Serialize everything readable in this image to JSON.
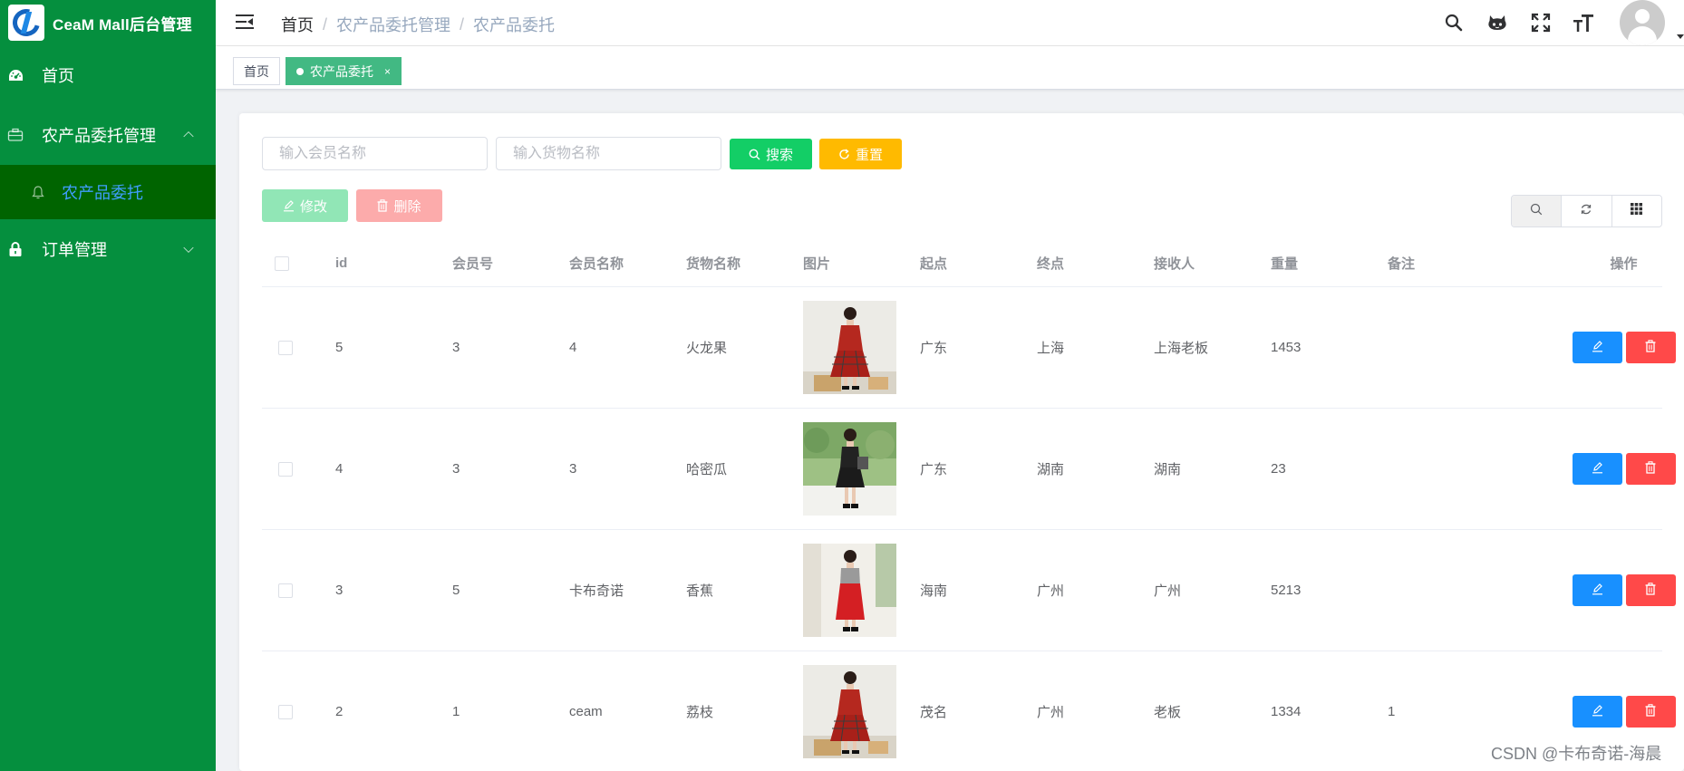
{
  "app": {
    "title": "CeaM Mall后台管理"
  },
  "sidebar": {
    "items": [
      {
        "label": "首页",
        "icon": "dashboard-icon"
      },
      {
        "label": "农产品委托管理",
        "icon": "briefcase-icon",
        "expanded": true,
        "children": [
          {
            "label": "农产品委托",
            "icon": "bell-icon",
            "active": true
          }
        ]
      },
      {
        "label": "订单管理",
        "icon": "lock-icon",
        "expanded": false
      }
    ]
  },
  "header": {
    "breadcrumb": [
      "首页",
      "农产品委托管理",
      "农产品委托"
    ],
    "separator": "/",
    "icons": [
      "search-icon",
      "github-icon",
      "fullscreen-icon",
      "font-size-icon",
      "avatar"
    ]
  },
  "tags": {
    "home": "首页",
    "active": "农产品委托",
    "close": "×"
  },
  "search": {
    "member_placeholder": "输入会员名称",
    "goods_placeholder": "输入货物名称",
    "search_label": "搜索",
    "reset_label": "重置",
    "edit_label": "修改",
    "delete_label": "删除"
  },
  "table": {
    "columns": [
      "id",
      "会员号",
      "会员名称",
      "货物名称",
      "图片",
      "起点",
      "终点",
      "接收人",
      "重量",
      "备注",
      "操作"
    ],
    "rows": [
      {
        "id": "5",
        "member_no": "3",
        "member_name": "4",
        "goods": "火龙果",
        "image": "girl-red-plaid-dress",
        "from": "广东",
        "to": "上海",
        "receiver": "上海老板",
        "weight": "1453",
        "note": ""
      },
      {
        "id": "4",
        "member_no": "3",
        "member_name": "3",
        "goods": "哈密瓜",
        "image": "girl-black-dress-garden",
        "from": "广东",
        "to": "湖南",
        "receiver": "湖南",
        "weight": "23",
        "note": ""
      },
      {
        "id": "3",
        "member_no": "5",
        "member_name": "卡布奇诺",
        "goods": "香蕉",
        "image": "girl-red-skirt",
        "from": "海南",
        "to": "广州",
        "receiver": "广州",
        "weight": "5213",
        "note": ""
      },
      {
        "id": "2",
        "member_no": "1",
        "member_name": "ceam",
        "goods": "荔枝",
        "image": "girl-red-plaid-dress",
        "from": "茂名",
        "to": "广州",
        "receiver": "老板",
        "weight": "1334",
        "note": "1"
      }
    ]
  },
  "colors": {
    "sidebar_bg": "#058f3e",
    "submenu_active_bg": "#006400",
    "active_text": "#409eff",
    "tag_active": "#42b983",
    "search_btn": "#13ce66",
    "reset_btn": "#ffba00",
    "edit_btn": "#1890ff",
    "delete_btn": "#ff4949"
  },
  "watermark": "CSDN @卡布奇诺-海晨"
}
